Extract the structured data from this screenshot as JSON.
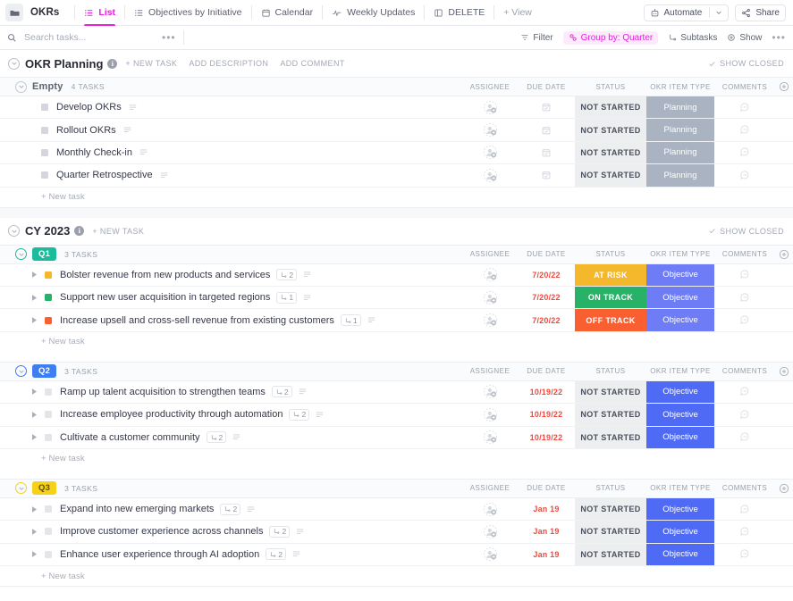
{
  "topbar": {
    "space_icon": "folder-icon",
    "space_title": "OKRs",
    "tabs": [
      {
        "label": "List",
        "icon": "list-view-icon",
        "active": true
      },
      {
        "label": "Objectives by Initiative",
        "icon": "list-view-icon",
        "active": false
      },
      {
        "label": "Calendar",
        "icon": "calendar-view-icon",
        "active": false
      },
      {
        "label": "Weekly Updates",
        "icon": "activity-view-icon",
        "active": false
      },
      {
        "label": "DELETE",
        "icon": "board-view-icon",
        "active": false
      }
    ],
    "add_view_label": "+ View",
    "automate_label": "Automate",
    "automate_icon": "robot-icon",
    "automate_chevron": "chevron-down-icon",
    "share_label": "Share",
    "share_icon": "share-icon"
  },
  "filterbar": {
    "search_placeholder": "Search tasks...",
    "search_value": "",
    "search_icon": "search-icon",
    "overflow_icon": "ellipsis-icon",
    "items": [
      {
        "label": "Filter",
        "icon": "filter-icon",
        "highlight": false
      },
      {
        "label": "Group by: Quarter",
        "icon": "group-icon",
        "highlight": true
      },
      {
        "label": "Subtasks",
        "icon": "subtask-icon",
        "highlight": false
      },
      {
        "label": "Show",
        "icon": "eye-icon",
        "highlight": false
      }
    ],
    "right_overflow_icon": "ellipsis-icon"
  },
  "columns": {
    "assignee": "ASSIGNEE",
    "due_date": "DUE DATE",
    "status": "STATUS",
    "okr_item_type": "OKR ITEM TYPE",
    "comments": "COMMENTS",
    "add_column_icon": "plus-circle-icon"
  },
  "colors": {
    "accent_pink": "#e520e0",
    "status_not_started_bg": "#eceef0",
    "status_at_risk": "#f5b72b",
    "status_on_track": "#27b268",
    "status_off_track": "#fa5f32",
    "type_planning": "#a9b3c1",
    "type_objective_q1": "#6e7cf5",
    "type_objective": "#4f6bf6",
    "q1_badge": "#1bbc9b",
    "q2_badge": "#3f7ef0",
    "q3_badge": "#f7d117",
    "due_date_overdue": "#ef4a3f"
  },
  "lists": [
    {
      "name": "OKR Planning",
      "info_icon": "info-icon",
      "actions": [
        "+ NEW TASK",
        "ADD DESCRIPTION",
        "ADD COMMENT"
      ],
      "show_closed": "SHOW CLOSED",
      "groups": [
        {
          "badge": "Empty",
          "badge_style": "plain",
          "count": "4 TASKS",
          "new_task_label": "+ New task",
          "tasks": [
            {
              "name": "Develop OKRs",
              "square": "#d3d6dc",
              "subtasks": "",
              "expandable": false,
              "assignee": "",
              "due": "",
              "due_empty_icon": "calendar-icon",
              "status": "NOT STARTED",
              "status_kind": "grey",
              "type": "Planning",
              "type_color": "#a9b3c1",
              "comments_icon": "comment-icon"
            },
            {
              "name": "Rollout OKRs",
              "square": "#d3d6dc",
              "subtasks": "",
              "expandable": false,
              "assignee": "",
              "due": "",
              "due_empty_icon": "calendar-icon",
              "status": "NOT STARTED",
              "status_kind": "grey",
              "type": "Planning",
              "type_color": "#a9b3c1",
              "comments_icon": "comment-icon"
            },
            {
              "name": "Monthly Check-in",
              "square": "#d3d6dc",
              "subtasks": "",
              "expandable": false,
              "assignee": "",
              "due": "",
              "due_empty_icon": "calendar-icon",
              "status": "NOT STARTED",
              "status_kind": "grey",
              "type": "Planning",
              "type_color": "#a9b3c1",
              "comments_icon": "comment-icon"
            },
            {
              "name": "Quarter Retrospective",
              "square": "#d3d6dc",
              "subtasks": "",
              "expandable": false,
              "assignee": "",
              "due": "",
              "due_empty_icon": "calendar-icon",
              "status": "NOT STARTED",
              "status_kind": "grey",
              "type": "Planning",
              "type_color": "#a9b3c1",
              "comments_icon": "comment-icon"
            }
          ]
        }
      ]
    },
    {
      "name": "CY 2023",
      "info_icon": "info-icon",
      "actions": [
        "+ NEW TASK"
      ],
      "show_closed": "SHOW CLOSED",
      "groups": [
        {
          "badge": "Q1",
          "badge_color": "#1bbc9b",
          "count": "3 TASKS",
          "new_task_label": "+ New task",
          "tasks": [
            {
              "name": "Bolster revenue from new products and services",
              "square": "#f5b72b",
              "subtasks": "2",
              "expandable": true,
              "due": "7/20/22",
              "status": "AT RISK",
              "status_color": "#f5b72b",
              "type": "Objective",
              "type_color": "#6e7cf5",
              "comments_icon": "comment-icon"
            },
            {
              "name": "Support new user acquisition in targeted regions",
              "square": "#27b268",
              "subtasks": "1",
              "expandable": true,
              "due": "7/20/22",
              "status": "ON TRACK",
              "status_color": "#27b268",
              "type": "Objective",
              "type_color": "#6e7cf5",
              "comments_icon": "comment-icon"
            },
            {
              "name": "Increase upsell and cross-sell revenue from existing customers",
              "square": "#fa5f32",
              "subtasks": "1",
              "expandable": true,
              "due": "7/20/22",
              "status": "OFF TRACK",
              "status_color": "#fa5f32",
              "type": "Objective",
              "type_color": "#6e7cf5",
              "comments_icon": "comment-icon"
            }
          ]
        },
        {
          "badge": "Q2",
          "badge_color": "#3f7ef0",
          "count": "3 TASKS",
          "new_task_label": "+ New task",
          "tasks": [
            {
              "name": "Ramp up talent acquisition to strengthen teams",
              "square": "#e3e5e9",
              "subtasks": "2",
              "expandable": true,
              "due": "10/19/22",
              "status": "NOT STARTED",
              "status_kind": "grey",
              "type": "Objective",
              "type_color": "#4f6bf6",
              "comments_icon": "comment-icon"
            },
            {
              "name": "Increase employee productivity through automation",
              "square": "#e3e5e9",
              "subtasks": "2",
              "expandable": true,
              "due": "10/19/22",
              "status": "NOT STARTED",
              "status_kind": "grey",
              "type": "Objective",
              "type_color": "#4f6bf6",
              "comments_icon": "comment-icon"
            },
            {
              "name": "Cultivate a customer community",
              "square": "#e3e5e9",
              "subtasks": "2",
              "expandable": true,
              "due": "10/19/22",
              "status": "NOT STARTED",
              "status_kind": "grey",
              "type": "Objective",
              "type_color": "#4f6bf6",
              "comments_icon": "comment-icon"
            }
          ]
        },
        {
          "badge": "Q3",
          "badge_color": "#f7d117",
          "count": "3 TASKS",
          "new_task_label": "+ New task",
          "tasks": [
            {
              "name": "Expand into new emerging markets",
              "square": "#e3e5e9",
              "subtasks": "2",
              "expandable": true,
              "due": "Jan 19",
              "status": "NOT STARTED",
              "status_kind": "grey",
              "type": "Objective",
              "type_color": "#4f6bf6",
              "comments_icon": "comment-icon"
            },
            {
              "name": "Improve customer experience across channels",
              "square": "#e3e5e9",
              "subtasks": "2",
              "expandable": true,
              "due": "Jan 19",
              "status": "NOT STARTED",
              "status_kind": "grey",
              "type": "Objective",
              "type_color": "#4f6bf6",
              "comments_icon": "comment-icon"
            },
            {
              "name": "Enhance user experience through AI adoption",
              "square": "#e3e5e9",
              "subtasks": "2",
              "expandable": true,
              "due": "Jan 19",
              "status": "NOT STARTED",
              "status_kind": "grey",
              "type": "Objective",
              "type_color": "#4f6bf6",
              "comments_icon": "comment-icon"
            }
          ]
        }
      ]
    }
  ]
}
